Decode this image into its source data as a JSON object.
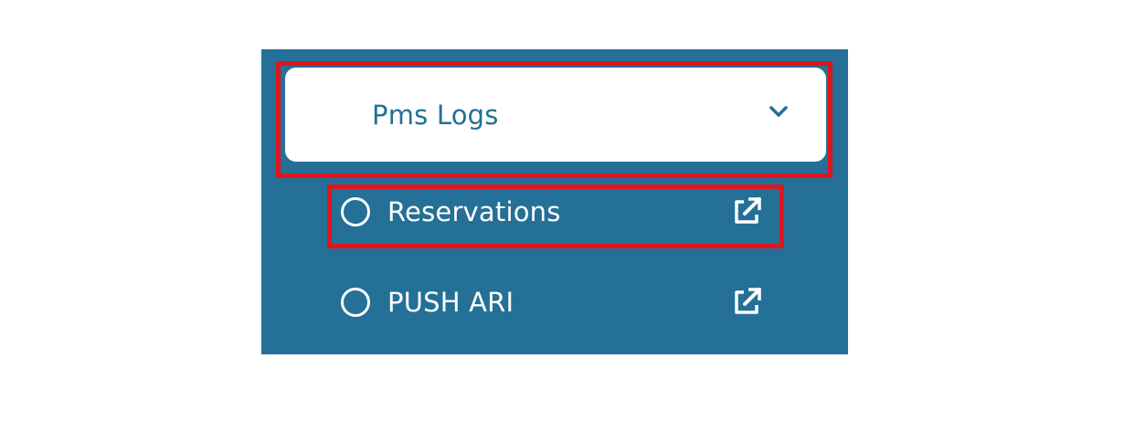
{
  "dropdown": {
    "label": "Pms Logs",
    "icon": "chevron-down-icon",
    "expanded": true
  },
  "menu": {
    "items": [
      {
        "label": "Reservations",
        "icon": "radio-circle-icon",
        "action_icon": "external-link-icon"
      },
      {
        "label": "PUSH ARI",
        "icon": "radio-circle-icon",
        "action_icon": "external-link-icon"
      }
    ]
  },
  "colors": {
    "panel_background": "#247096",
    "header_background": "#ffffff",
    "header_text": "#247096",
    "item_text": "#ffffff",
    "highlight": "#e0141c"
  }
}
